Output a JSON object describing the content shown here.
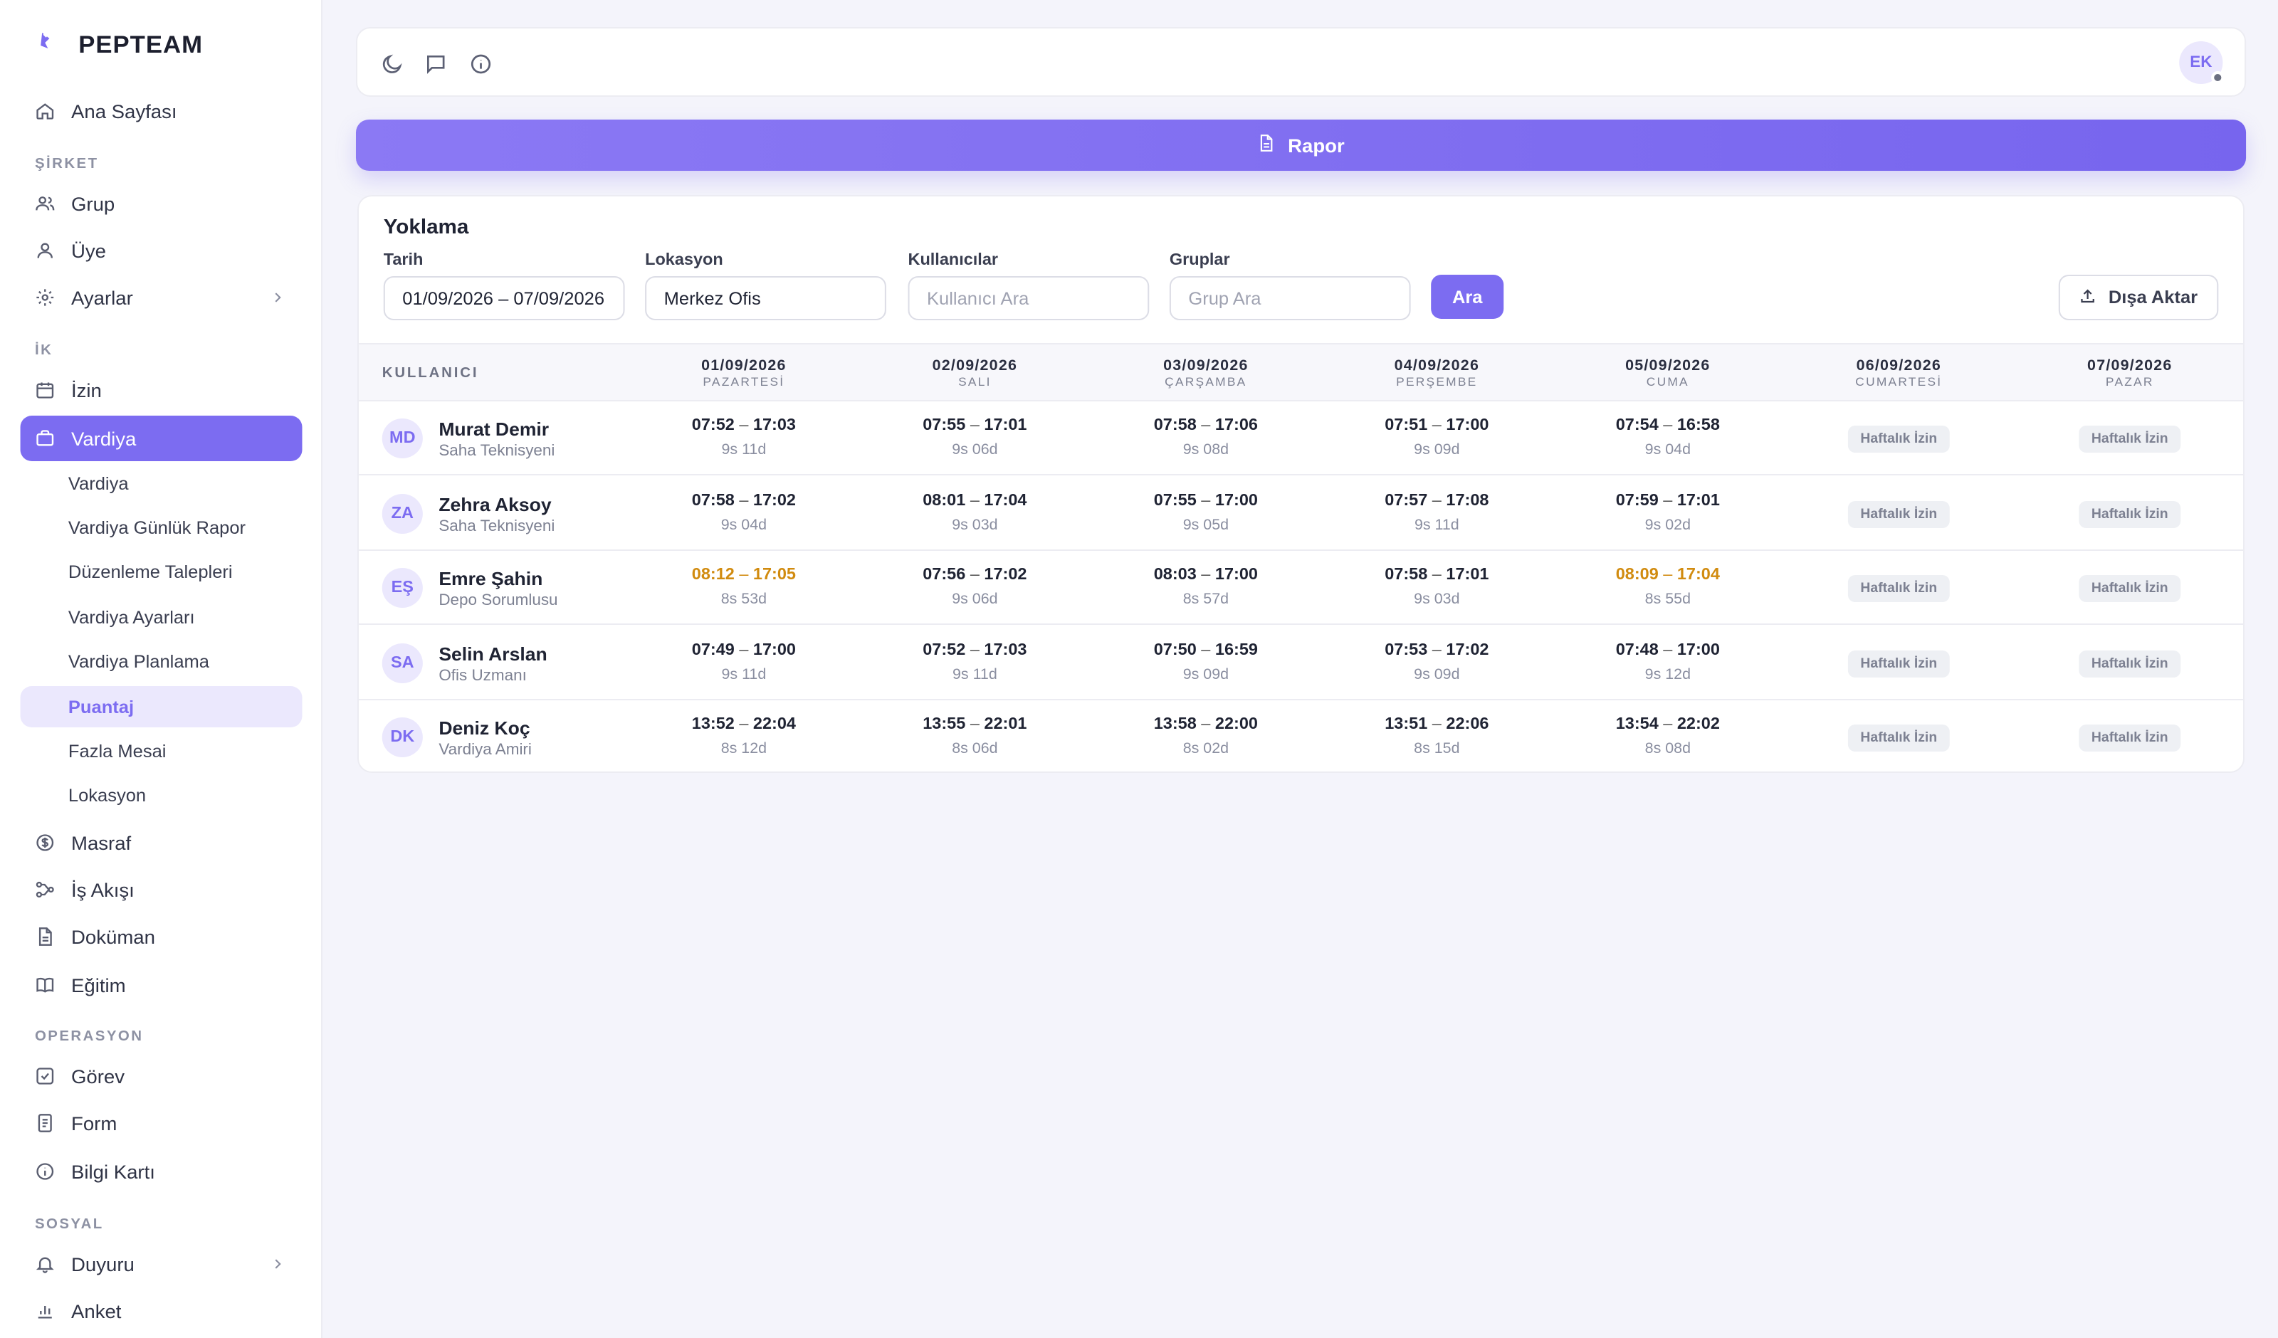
{
  "brand": {
    "name": "PEPTEAM",
    "logo_text": "pepteam"
  },
  "sidebar": {
    "home": "Ana Sayfası",
    "sections": {
      "company": "ŞİRKET",
      "hr": "İK",
      "ops": "OPERASYON",
      "social": "SOSYAL"
    },
    "company_items": [
      "Grup",
      "Üye",
      "Ayarlar"
    ],
    "hr_items": [
      "İzin",
      "Vardiya"
    ],
    "vardiya_sub": [
      "Vardiya",
      "Vardiya Günlük Rapor",
      "Düzenleme Talepleri",
      "Vardiya Ayarları",
      "Vardiya Planlama",
      "Puantaj",
      "Fazla Mesai",
      "Lokasyon"
    ],
    "hr_items2": [
      "Masraf",
      "İş Akışı",
      "Doküman",
      "Eğitim"
    ],
    "ops_items": [
      "Görev",
      "Form",
      "Bilgi Kartı"
    ],
    "social_items": [
      "Duyuru",
      "Anket"
    ]
  },
  "topbar": {
    "user_initials": "EK",
    "icons": [
      "moon-icon",
      "chat-icon",
      "info-icon"
    ]
  },
  "report_button": "Rapor",
  "card": {
    "title": "Yoklama",
    "filters": {
      "date": {
        "label": "Tarih",
        "value": "01/09/2026 – 07/09/2026"
      },
      "location": {
        "label": "Lokasyon",
        "value": "Merkez Ofis"
      },
      "users": {
        "label": "Kullanıcılar",
        "placeholder": "Kullanıcı Ara"
      },
      "groups": {
        "label": "Gruplar",
        "placeholder": "Grup Ara"
      },
      "search_button": "Ara",
      "export_button": "Dışa Aktar"
    }
  },
  "table": {
    "user_header": "KULLANICI",
    "days": [
      {
        "date": "01/09/2026",
        "weekday": "PAZARTESİ"
      },
      {
        "date": "02/09/2026",
        "weekday": "SALI"
      },
      {
        "date": "03/09/2026",
        "weekday": "ÇARŞAMBA"
      },
      {
        "date": "04/09/2026",
        "weekday": "PERŞEMBE"
      },
      {
        "date": "05/09/2026",
        "weekday": "CUMA"
      },
      {
        "date": "06/09/2026",
        "weekday": "CUMARTESİ"
      },
      {
        "date": "07/09/2026",
        "weekday": "PAZAR"
      }
    ],
    "rows": [
      {
        "initials": "MD",
        "name": "Murat Demir",
        "role": "Saha Teknisyeni",
        "cells": [
          {
            "in": "07:52",
            "out": "17:03",
            "dur": "9s 11d",
            "late": false
          },
          {
            "in": "07:55",
            "out": "17:01",
            "dur": "9s 06d",
            "late": false
          },
          {
            "in": "07:58",
            "out": "17:06",
            "dur": "9s 08d",
            "late": false
          },
          {
            "in": "07:51",
            "out": "17:00",
            "dur": "9s 09d",
            "late": false
          },
          {
            "in": "07:54",
            "out": "16:58",
            "dur": "9s 04d",
            "late": false
          },
          {
            "off": "Haftalık İzin"
          },
          {
            "off": "Haftalık İzin"
          }
        ]
      },
      {
        "initials": "ZA",
        "name": "Zehra Aksoy",
        "role": "Saha Teknisyeni",
        "cells": [
          {
            "in": "07:58",
            "out": "17:02",
            "dur": "9s 04d",
            "late": false
          },
          {
            "in": "08:01",
            "out": "17:04",
            "dur": "9s 03d",
            "late": false
          },
          {
            "in": "07:55",
            "out": "17:00",
            "dur": "9s 05d",
            "late": false
          },
          {
            "in": "07:57",
            "out": "17:08",
            "dur": "9s 11d",
            "late": false
          },
          {
            "in": "07:59",
            "out": "17:01",
            "dur": "9s 02d",
            "late": false
          },
          {
            "off": "Haftalık İzin"
          },
          {
            "off": "Haftalık İzin"
          }
        ]
      },
      {
        "initials": "EŞ",
        "name": "Emre Şahin",
        "role": "Depo Sorumlusu",
        "cells": [
          {
            "in": "08:12",
            "out": "17:05",
            "dur": "8s 53d",
            "late": true
          },
          {
            "in": "07:56",
            "out": "17:02",
            "dur": "9s 06d",
            "late": false
          },
          {
            "in": "08:03",
            "out": "17:00",
            "dur": "8s 57d",
            "late": false
          },
          {
            "in": "07:58",
            "out": "17:01",
            "dur": "9s 03d",
            "late": false
          },
          {
            "in": "08:09",
            "out": "17:04",
            "dur": "8s 55d",
            "late": true
          },
          {
            "off": "Haftalık İzin"
          },
          {
            "off": "Haftalık İzin"
          }
        ]
      },
      {
        "initials": "SA",
        "name": "Selin Arslan",
        "role": "Ofis Uzmanı",
        "cells": [
          {
            "in": "07:49",
            "out": "17:00",
            "dur": "9s 11d",
            "late": false
          },
          {
            "in": "07:52",
            "out": "17:03",
            "dur": "9s 11d",
            "late": false
          },
          {
            "in": "07:50",
            "out": "16:59",
            "dur": "9s 09d",
            "late": false
          },
          {
            "in": "07:53",
            "out": "17:02",
            "dur": "9s 09d",
            "late": false
          },
          {
            "in": "07:48",
            "out": "17:00",
            "dur": "9s 12d",
            "late": false
          },
          {
            "off": "Haftalık İzin"
          },
          {
            "off": "Haftalık İzin"
          }
        ]
      },
      {
        "initials": "DK",
        "name": "Deniz Koç",
        "role": "Vardiya Amiri",
        "cells": [
          {
            "in": "13:52",
            "out": "22:04",
            "dur": "8s 12d",
            "late": false
          },
          {
            "in": "13:55",
            "out": "22:01",
            "dur": "8s 06d",
            "late": false
          },
          {
            "in": "13:58",
            "out": "22:00",
            "dur": "8s 02d",
            "late": false
          },
          {
            "in": "13:51",
            "out": "22:06",
            "dur": "8s 15d",
            "late": false
          },
          {
            "in": "13:54",
            "out": "22:02",
            "dur": "8s 08d",
            "late": false
          },
          {
            "off": "Haftalık İzin"
          },
          {
            "off": "Haftalık İzin"
          }
        ]
      }
    ]
  },
  "colors": {
    "accent": "#7c6cf1",
    "late": "#d18b0f",
    "background": "#f4f4fb"
  }
}
